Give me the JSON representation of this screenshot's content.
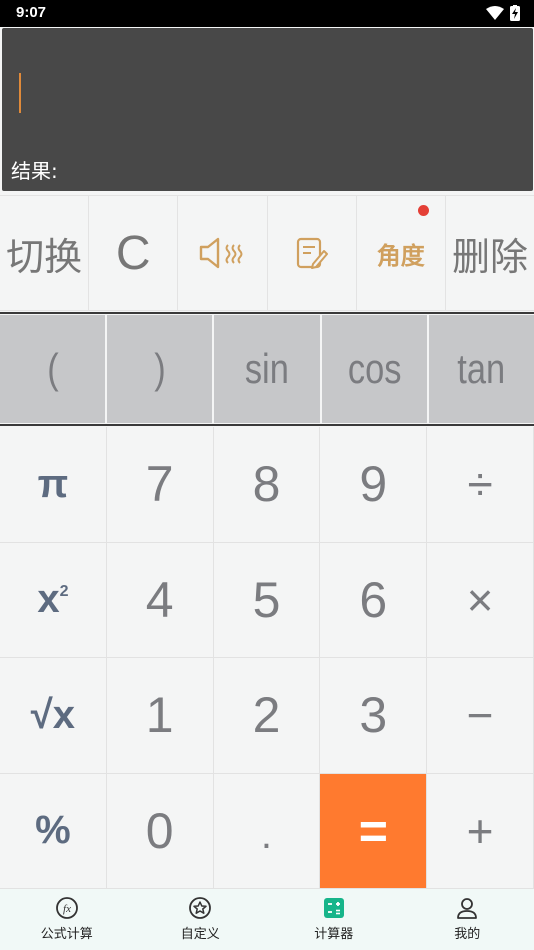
{
  "status_bar": {
    "time": "9:07"
  },
  "display": {
    "expression": "",
    "result_label": "结果:"
  },
  "function_row": {
    "switch_label": "切换",
    "clear_label": "C",
    "angle_label": "角度",
    "delete_label": "删除"
  },
  "sci_row": {
    "open_paren": "(",
    "close_paren": ")",
    "sin": "sin",
    "cos": "cos",
    "tan": "tan"
  },
  "keypad": {
    "pi": "π",
    "seven": "7",
    "eight": "8",
    "nine": "9",
    "divide": "÷",
    "square_base": "x",
    "square_exp": "2",
    "four": "4",
    "five": "5",
    "six": "6",
    "multiply": "×",
    "sqrt": "√x",
    "one": "1",
    "two": "2",
    "three": "3",
    "minus": "−",
    "percent": "%",
    "zero": "0",
    "dot": ".",
    "equals": "=",
    "plus": "+"
  },
  "bottom_nav": {
    "items": [
      {
        "label": "公式计算",
        "icon": "fx-icon"
      },
      {
        "label": "自定义",
        "icon": "star-badge-icon"
      },
      {
        "label": "计算器",
        "icon": "calculator-icon"
      },
      {
        "label": "我的",
        "icon": "person-icon"
      }
    ],
    "active_index": 2,
    "active_color": "#17b58a"
  },
  "colors": {
    "equals_bg": "#ff7a2f",
    "angle_text": "#d0a05e",
    "badge_dot": "#e43f36",
    "display_bg": "#484848"
  }
}
